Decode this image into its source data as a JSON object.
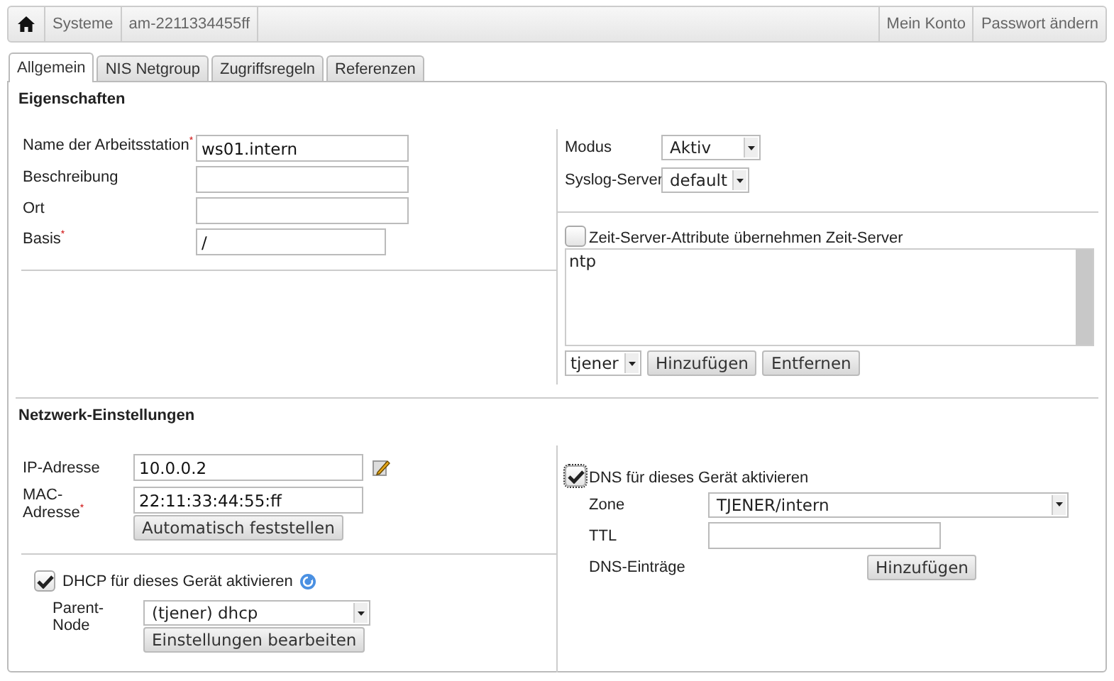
{
  "breadcrumb": [
    "Systeme",
    "am-2211334455ff"
  ],
  "account_links": [
    "Mein Konto",
    "Passwort ändern"
  ],
  "tabs": [
    {
      "label": "Allgemein",
      "selected": true
    },
    {
      "label": "NIS Netgroup",
      "selected": false
    },
    {
      "label": "Zugriffsregeln",
      "selected": false
    },
    {
      "label": "Referenzen",
      "selected": false
    }
  ],
  "properties": {
    "title": "Eigenschaften",
    "fields": [
      {
        "label": "Name der Arbeitsstation$^{*}$",
        "value": "ws01.intern"
      },
      {
        "label": "Beschreibung"
      },
      {
        "label": "Ort"
      },
      {
        "label": "Basis$^{*}$",
        "value": "/"
      }
    ],
    "selects": [
      {
        "label": "Modus",
        "value": "Aktiv"
      },
      {
        "label": "Syslog-Server",
        "value": "default"
      }
    ],
    "time_server": {
      "label": "Zeit-Server-Attribute übernehmen Zeit-Server",
      "checked": false,
      "entries": [
        "ntp"
      ],
      "select": "tjener",
      "buttons": [
        "Hinzufügen",
        "Entfernen"
      ]
    }
  },
  "network": {
    "title": "Netzwerk-Einstellungen",
    "ip": {
      "label": "IP-Adresse",
      "value": "10.0.0.2"
    },
    "mac": {
      "label": "MAC-Adresse$^{*}$",
      "value": "22:11:33:44:55:ff",
      "button": "Automatisch feststellen"
    },
    "dhcp": {
      "label": "DHCP für dieses Gerät aktivieren",
      "checked": true,
      "parent_label": "Parent-Node",
      "parent_value": "(tjener) dhcp",
      "button": "Einstellungen bearbeiten"
    },
    "dns": {
      "label": "DNS für dieses Gerät aktivieren",
      "checked": true,
      "zone_label": "Zone",
      "zone_value": "TJENER/intern",
      "ttl_label": "TTL",
      "entries_label": "DNS-Einträge",
      "button": "Hinzufügen"
    }
  }
}
